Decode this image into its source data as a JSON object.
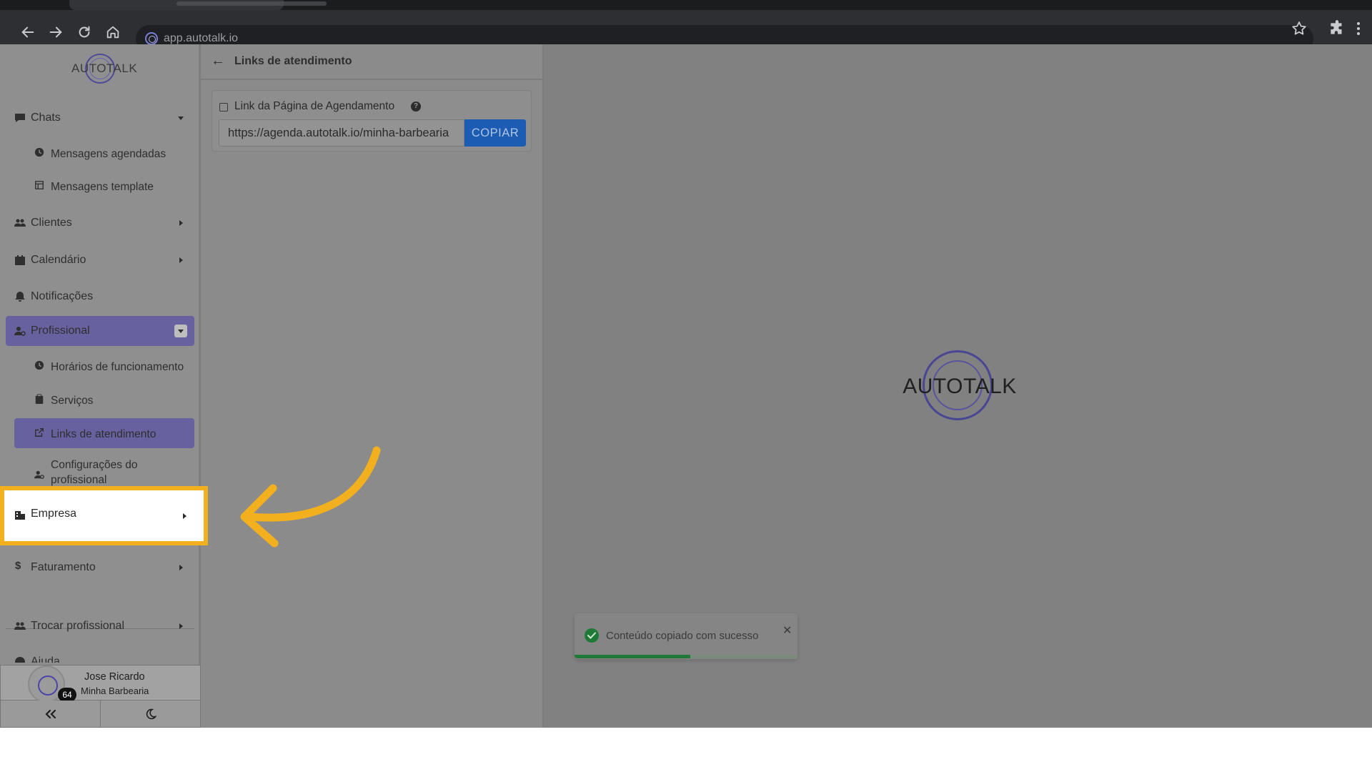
{
  "browser": {
    "url": "app.autotalk.io"
  },
  "sidebar": {
    "logo_text": "AUTOTALK",
    "items": [
      {
        "label": "Chats",
        "icon": "chat-icon",
        "expand": "down"
      },
      {
        "label": "Mensagens agendadas",
        "icon": "clock-icon",
        "sub": true
      },
      {
        "label": "Mensagens template",
        "icon": "template-icon",
        "sub": true
      },
      {
        "label": "Clientes",
        "icon": "users-icon",
        "expand": "right"
      },
      {
        "label": "Calendário",
        "icon": "calendar-icon",
        "expand": "right"
      },
      {
        "label": "Notificações",
        "icon": "bell-icon"
      },
      {
        "label": "Profissional",
        "icon": "user-gear-icon",
        "expand": "down",
        "selected": true
      },
      {
        "label": "Horários de funcionamento",
        "icon": "clock-icon",
        "sub": true
      },
      {
        "label": "Serviços",
        "icon": "clipboard-icon",
        "sub": true
      },
      {
        "label": "Links de atendimento",
        "icon": "external-link-icon",
        "sub": true,
        "selected": true
      },
      {
        "label": "Configurações do profissional",
        "icon": "user-gear-icon",
        "sub": true
      },
      {
        "label": "Empresa",
        "icon": "building-icon",
        "expand": "right",
        "highlighted": true
      },
      {
        "label": "Faturamento",
        "icon": "dollar-icon",
        "expand": "right"
      },
      {
        "label": "Trocar profissional",
        "icon": "users-swap-icon",
        "expand": "right"
      },
      {
        "label": "Ajuda",
        "icon": "help-icon",
        "expand": "right"
      }
    ],
    "user": {
      "name": "Jose Ricardo",
      "company": "Minha Barbearia",
      "badge": "64"
    }
  },
  "panel": {
    "title": "Links de atendimento",
    "card_label": "Link da Página de Agendamento",
    "link_value": "https://agenda.autotalk.io/minha-barbearia",
    "copy_label": "COPIAR"
  },
  "main": {
    "logo_text": "AUTOTALK"
  },
  "toast": {
    "message": "Conteúdo copiado com sucesso",
    "progress": 0.52
  },
  "colors": {
    "accent_highlight": "#f2b01e",
    "primary_button": "#1d5cb3",
    "selected_nav": "#67619f",
    "success": "#1e7a36"
  }
}
